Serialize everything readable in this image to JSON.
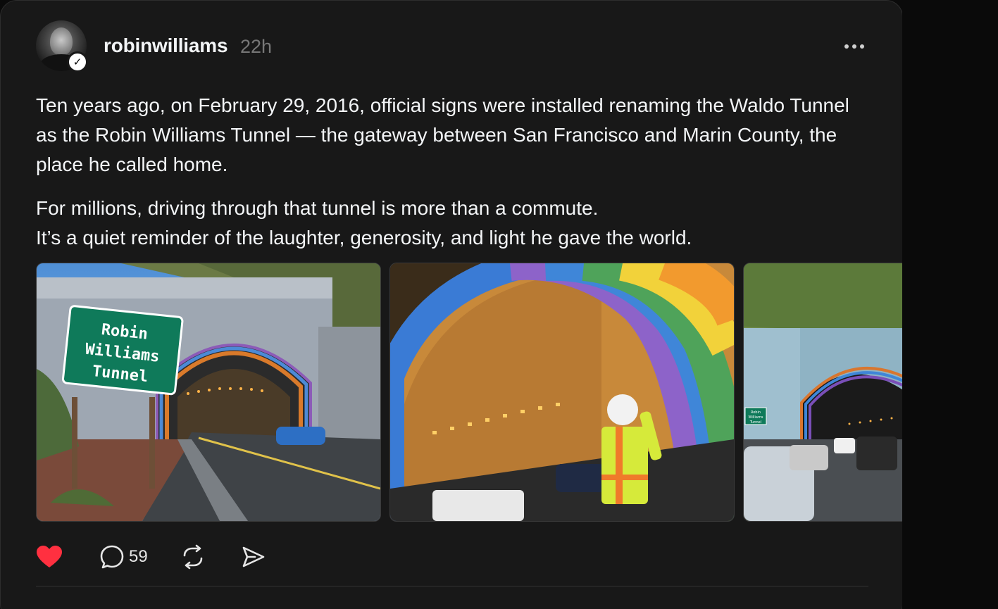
{
  "post": {
    "username": "robinwilliams",
    "timestamp": "22h",
    "verified": true,
    "paragraphs": [
      "Ten years ago, on February 29, 2016, official signs were installed renaming the Waldo Tunnel as the Robin Williams Tunnel — the gateway between San Francisco and Marin County, the place he called home.",
      "For millions, driving through that tunnel is more than a commute.\nIt’s a quiet reminder of the laughter, generosity, and light he gave the world."
    ],
    "media": [
      {
        "name": "tunnel-sign-photo",
        "sign_text": [
          "Robin",
          "Williams",
          "Tunnel"
        ]
      },
      {
        "name": "rainbow-painting-photo"
      },
      {
        "name": "tunnel-traffic-photo",
        "sign_text": [
          "Robin",
          "Williams",
          "Tunnel"
        ]
      }
    ],
    "actions": {
      "like_icon": "heart-icon-filled",
      "reply_icon": "speech-bubble-icon",
      "reply_count": "59",
      "repost_icon": "repost-icon",
      "share_icon": "send-icon"
    }
  },
  "colors": {
    "card_bg": "#181818",
    "page_bg": "#0a0a0a",
    "text": "#f3f5f7",
    "muted": "#777777",
    "like_red": "#ff3040"
  }
}
